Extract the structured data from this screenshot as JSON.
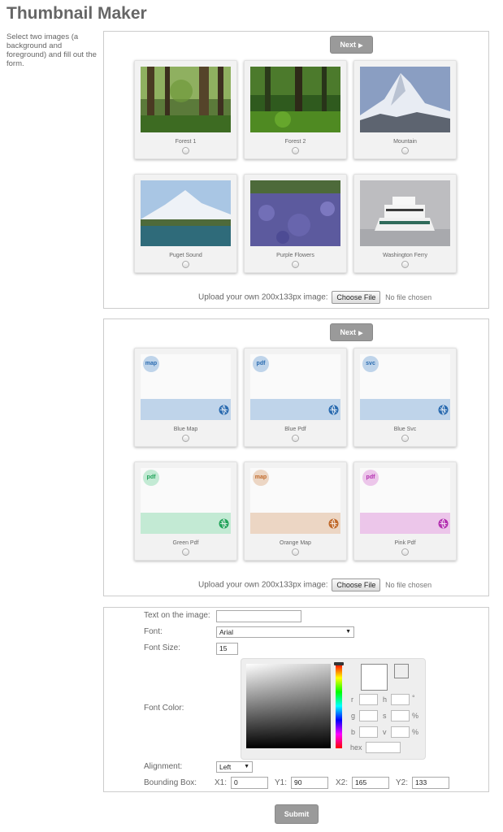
{
  "title": "Thumbnail Maker",
  "intro": "Select two images (a background and foreground) and fill out the form.",
  "next_label": "Next",
  "upload": {
    "label": "Upload your own 200x133px image:",
    "button": "Choose File",
    "status": "No file chosen"
  },
  "backgrounds": [
    {
      "label": "Forest 1"
    },
    {
      "label": "Forest 2"
    },
    {
      "label": "Mountain"
    },
    {
      "label": "Puget Sound"
    },
    {
      "label": "Purple Flowers"
    },
    {
      "label": "Washington Ferry"
    }
  ],
  "foregrounds": [
    {
      "label": "Blue Map",
      "badge": "map",
      "color": "#bfd4ea",
      "accent": "#2a6bb0"
    },
    {
      "label": "Blue Pdf",
      "badge": "pdf",
      "color": "#bfd4ea",
      "accent": "#2a6bb0"
    },
    {
      "label": "Blue Svc",
      "badge": "svc",
      "color": "#bfd4ea",
      "accent": "#2a6bb0"
    },
    {
      "label": "Green Pdf",
      "badge": "pdf",
      "color": "#c3ead4",
      "accent": "#22a35a"
    },
    {
      "label": "Orange Map",
      "badge": "map",
      "color": "#ecd6c4",
      "accent": "#c0692a"
    },
    {
      "label": "Pink Pdf",
      "badge": "pdf",
      "color": "#ecc6ea",
      "accent": "#b32fb0"
    }
  ],
  "form": {
    "text_label": "Text on the image:",
    "text_value": "",
    "font_label": "Font:",
    "font_value": "Arial",
    "size_label": "Font Size:",
    "size_value": "15",
    "color_label": "Font Color:",
    "picker": {
      "r": "r",
      "g": "g",
      "b": "b",
      "h": "h",
      "s": "s",
      "v": "v",
      "deg": "°",
      "pct": "%",
      "hex": "hex"
    },
    "align_label": "Alignment:",
    "align_value": "Left",
    "bbox_label": "Bounding Box:",
    "x1_label": "X1:",
    "x1": "0",
    "y1_label": "Y1:",
    "y1": "90",
    "x2_label": "X2:",
    "x2": "165",
    "y2_label": "Y2:",
    "y2": "133"
  },
  "submit_label": "Submit"
}
